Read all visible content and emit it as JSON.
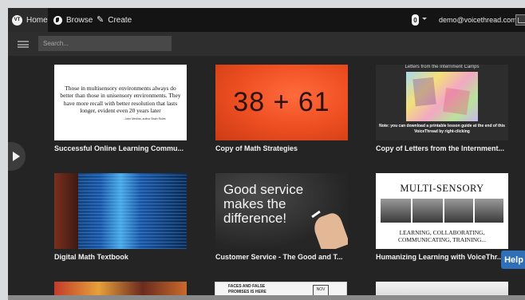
{
  "topbar": {
    "home_label": "Home",
    "browse_label": "Browse",
    "create_label": "Create",
    "logo_text": "VT",
    "notification_count": "0",
    "user_email": "demo@voicethread.com"
  },
  "search": {
    "placeholder": "Search..."
  },
  "threads": [
    {
      "title": "Successful Online Learning Commu...",
      "quote": "Those in multisensory environments always do better than those in unisensory environments. They have more recall with better resolution that lasts longer, evident even 20 years later",
      "author": "- John Medina, author Brain Rules"
    },
    {
      "title": "Copy of Math Strategies",
      "image_text": "38 + 61"
    },
    {
      "title": "Copy of Letters from the Internment...",
      "header": "Letters from the Internment Camps",
      "note": "Note: you can download a printable lesson guide at the end of this VoiceThread by right-clicking"
    },
    {
      "title": "Digital Math Textbook"
    },
    {
      "title": "Customer Service - The Good and T...",
      "image_text": "Good service makes the difference!"
    },
    {
      "title": "Humanizing Learning with VoiceThr...",
      "image_title": "MULTI-SENSORY",
      "image_subtitle": "LEARNING, COLLABORATING, COMMUNICATING, TRAINING..."
    }
  ],
  "partial_row": {
    "thumb2_line1": "FACES AND FALSE",
    "thumb2_line2": "PROMISES IS HERE",
    "thumb2_note": "NOV"
  },
  "help": {
    "label": "Help"
  },
  "colors": {
    "topbar": "#141414",
    "background": "#242424",
    "help_button": "#2f6fb7"
  }
}
